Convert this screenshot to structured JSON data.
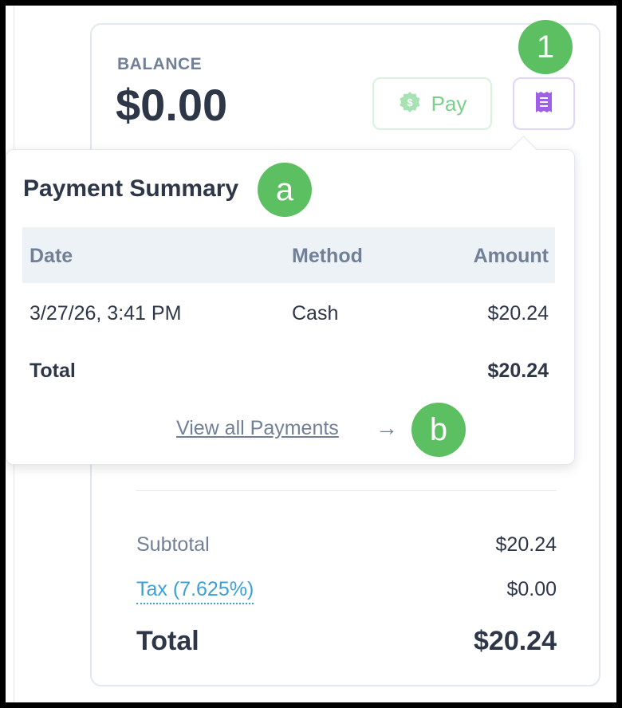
{
  "balance": {
    "label": "BALANCE",
    "amount": "$0.00",
    "pay_label": "Pay",
    "pay_icon": "cash-icon",
    "receipt_icon": "receipt-icon"
  },
  "markers": {
    "one": "1",
    "a": "a",
    "b": "b"
  },
  "payment_summary": {
    "title": "Payment Summary",
    "columns": [
      "Date",
      "Method",
      "Amount"
    ],
    "rows": [
      {
        "date": "3/27/26, 3:41 PM",
        "method": "Cash",
        "amount": "$20.24"
      }
    ],
    "total_label": "Total",
    "total_amount": "$20.24",
    "view_all_label": "View all Payments",
    "view_all_arrow": "→"
  },
  "summary": {
    "subtotal_label": "Subtotal",
    "subtotal_value": "$20.24",
    "tax_label": "Tax (7.625%)",
    "tax_value": "$0.00",
    "total_label": "Total",
    "total_value": "$20.24"
  },
  "colors": {
    "pay_green": "#7ad08b",
    "receipt_purple": "#9f5fe8",
    "marker_green": "#5cbf62",
    "tax_link_blue": "#3ba0d8"
  }
}
